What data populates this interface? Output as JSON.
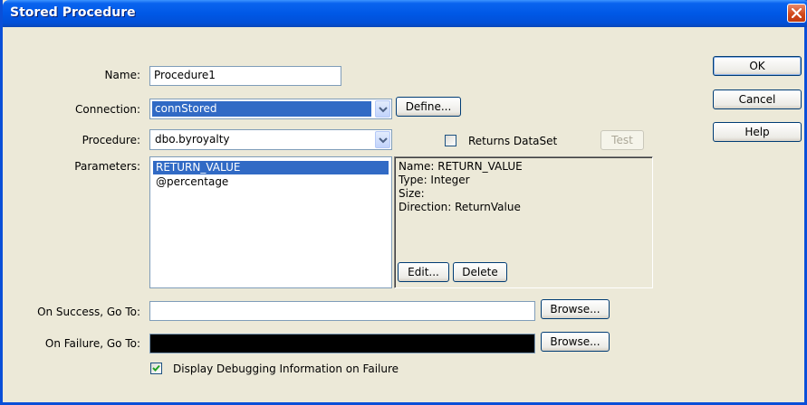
{
  "window": {
    "title": "Stored Procedure"
  },
  "labels": {
    "name": "Name:",
    "connection": "Connection:",
    "procedure": "Procedure:",
    "parameters": "Parameters:",
    "on_success": "On Success, Go To:",
    "on_failure": "On Failure, Go To:"
  },
  "fields": {
    "name_value": "Procedure1",
    "connection_value": "connStored",
    "procedure_value": "dbo.byroyalty",
    "on_success_value": "",
    "on_failure_value": ""
  },
  "buttons": {
    "define": "Define...",
    "test": "Test",
    "edit": "Edit...",
    "delete": "Delete",
    "browse_success": "Browse...",
    "browse_failure": "Browse...",
    "ok": "OK",
    "cancel": "Cancel",
    "help": "Help"
  },
  "checkboxes": {
    "returns_dataset": {
      "label": "Returns DataSet",
      "checked": false
    },
    "debug": {
      "label": "Display Debugging Information on Failure",
      "checked": true
    }
  },
  "parameters": {
    "items": [
      "RETURN_VALUE",
      "@percentage"
    ],
    "selected_index": 0,
    "details": {
      "name": "Name: RETURN_VALUE",
      "type": "Type: Integer",
      "size": "Size:",
      "direction": "Direction: ReturnValue"
    }
  },
  "colors": {
    "selection": "#316ac5",
    "titlebar": "#0058e6",
    "dialog_bg": "#ece9d8"
  }
}
